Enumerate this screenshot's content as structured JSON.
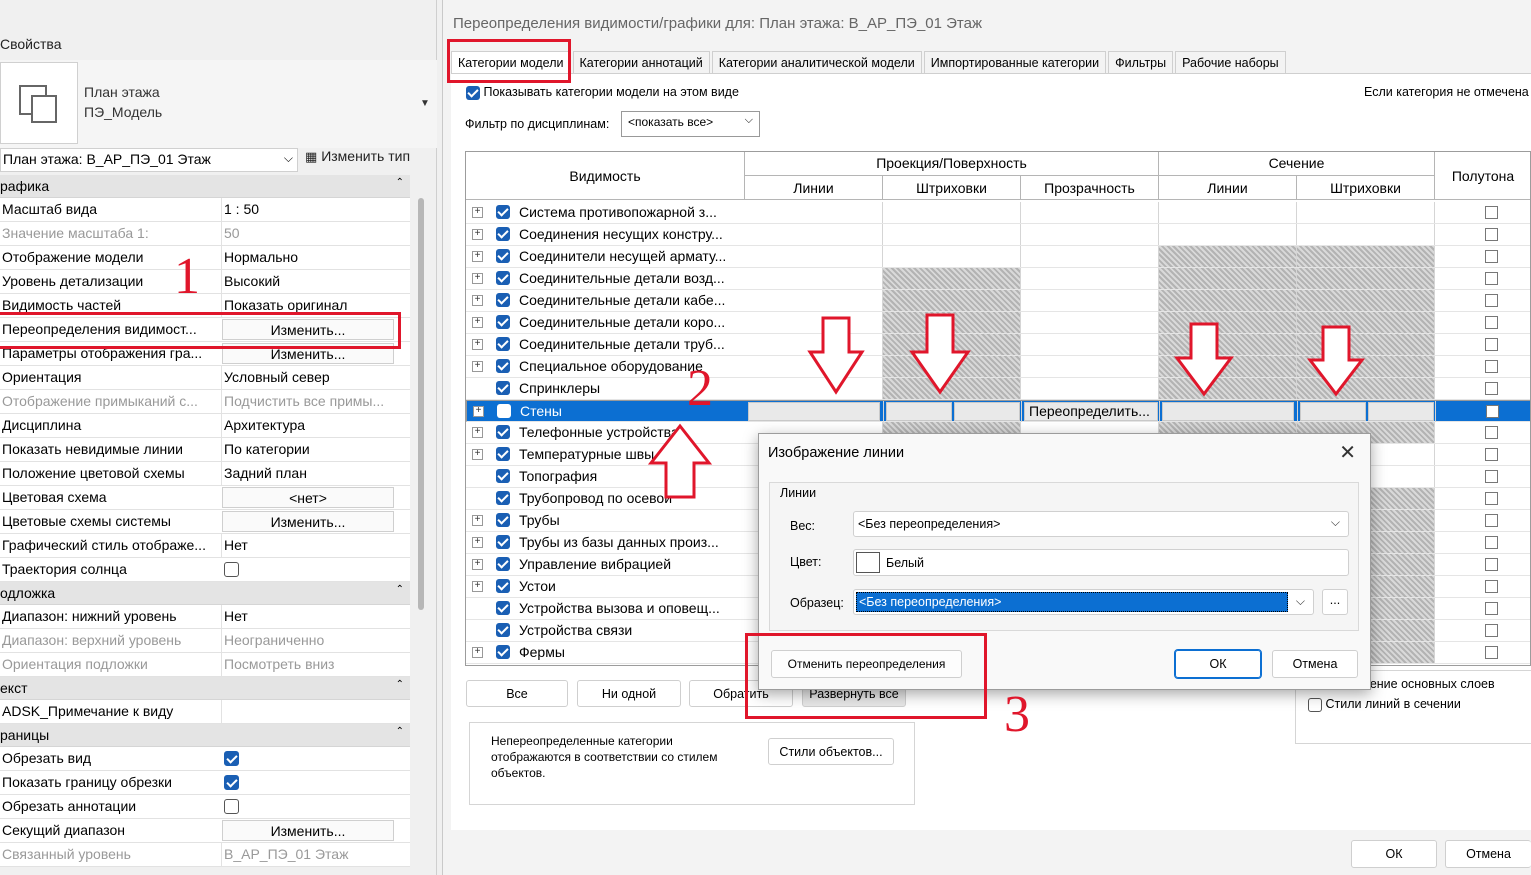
{
  "properties": {
    "title": "Свойства",
    "type_name_1": "План этажа",
    "type_name_2": "ПЭ_Модель",
    "view_selector": "План этажа: В_АР_ПЭ_01 Этаж",
    "edit_type": "Изменить тип",
    "section_graphics": "рафика",
    "rows_graphics": [
      {
        "k": "Масштаб вида",
        "v": "1 : 50"
      },
      {
        "k": "Значение масштаба    1:",
        "v": "50"
      },
      {
        "k": "Отображение модели",
        "v": "Нормально"
      },
      {
        "k": "Уровень детализации",
        "v": "Высокий"
      },
      {
        "k": "Видимость частей",
        "v": "Показать оригинал"
      },
      {
        "k": "Переопределения видимост...",
        "v": "Изменить..."
      },
      {
        "k": "Параметры отображения гра...",
        "v": "Изменить..."
      },
      {
        "k": "Ориентация",
        "v": "Условный север"
      },
      {
        "k": "Отображение примыканий с...",
        "v": "Подчистить все примы..."
      },
      {
        "k": "Дисциплина",
        "v": "Архитектура"
      },
      {
        "k": "Показать невидимые линии",
        "v": "По категории"
      },
      {
        "k": "Положение цветовой схемы",
        "v": "Задний план"
      },
      {
        "k": "Цветовая схема",
        "v": "<нет>"
      },
      {
        "k": "Цветовые схемы системы",
        "v": "Изменить..."
      },
      {
        "k": "Графический стиль отображе...",
        "v": "Нет"
      },
      {
        "k": "Траектория солнца",
        "v": ""
      }
    ],
    "section_underlay": "одложка",
    "rows_underlay": [
      {
        "k": "Диапазон: нижний уровень",
        "v": "Нет"
      },
      {
        "k": "Диапазон: верхний уровень",
        "v": "Неограниченно"
      },
      {
        "k": "Ориентация подложки",
        "v": "Посмотреть вниз"
      }
    ],
    "section_text": "екст",
    "rows_text": [
      {
        "k": "ADSK_Примечание к виду",
        "v": ""
      }
    ],
    "section_bounds": "раницы",
    "rows_bounds": [
      {
        "k": "Обрезать вид",
        "v": ""
      },
      {
        "k": "Показать границу обрезки",
        "v": ""
      },
      {
        "k": "Обрезать аннотации",
        "v": ""
      },
      {
        "k": "Секущий диапазон",
        "v": "Изменить..."
      },
      {
        "k": "Связанный уровень",
        "v": "В_АР_ПЭ_01 Этаж"
      }
    ]
  },
  "vg": {
    "title": "Переопределения видимости/графики для: План этажа: В_АР_ПЭ_01 Этаж",
    "tabs": [
      "Категории модели",
      "Категории аннотаций",
      "Категории аналитической модели",
      "Импортированные категории",
      "Фильтры",
      "Рабочие наборы"
    ],
    "show_categories": "Показывать категории модели на этом виде",
    "note_right": "Если категория не отмечена",
    "filter_label": "Фильтр по дисциплинам:",
    "filter_value": "<показать все>",
    "headers": {
      "visibility": "Видимость",
      "projection": "Проекция/Поверхность",
      "cut": "Сечение",
      "halftone": "Полутона",
      "lines": "Линии",
      "patterns": "Штриховки",
      "transparency": "Прозрачность"
    },
    "rows": [
      "Система противопожарной з...",
      "Соединения несущих констру...",
      "Соединители несущей армату...",
      "Соединительные детали возд...",
      "Соединительные детали кабе...",
      "Соединительные детали коро...",
      "Соединительные детали труб...",
      "Специальное оборудование",
      "Спринклеры",
      "Стены",
      "Телефонные устройства",
      "Температурные швы",
      "Топография",
      "Трубопровод по осевой",
      "Трубы",
      "Трубы из базы данных произ...",
      "Управление вибрацией",
      "Устои",
      "Устройства вызова и оповещ...",
      "Устройства связи",
      "Фермы"
    ],
    "override_cell": "Переопределить...",
    "buttons": {
      "all": "Все",
      "none": "Ни одной",
      "invert": "Обратить",
      "expand": "Развернуть все",
      "object_styles": "Стили объектов...",
      "ok": "ОК",
      "cancel": "Отмена"
    },
    "note_text": "Непереопределенные категории отображаются в соответствии со стилем объектов.",
    "right_opt1": "еление основных слоев",
    "right_opt2": "Стили линий в сечении"
  },
  "line_dialog": {
    "title": "Изображение линии",
    "group": "Линии",
    "weight_label": "Вес:",
    "weight_value": "<Без переопределения>",
    "color_label": "Цвет:",
    "color_value": "Белый",
    "pattern_label": "Образец:",
    "pattern_value": "<Без переопределения>",
    "more": "...",
    "reset": "Отменить переопределения",
    "ok": "ОК",
    "cancel": "Отмена"
  },
  "annotations": {
    "n1": "1",
    "n2": "2",
    "n3": "3"
  },
  "colors": {
    "accent": "#0c6fd2",
    "annotation": "#e0162b"
  }
}
